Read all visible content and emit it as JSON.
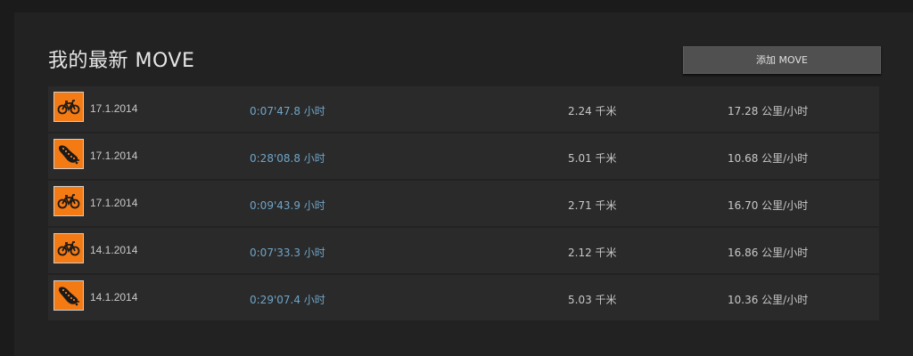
{
  "header": {
    "title": "我的最新 MOVE",
    "add_button_label": "添加 MOVE"
  },
  "colors": {
    "accent_orange": "#f47a14",
    "duration_blue": "#6fa5c8"
  },
  "moves": [
    {
      "icon": "bike-icon",
      "date": "17.1.2014",
      "duration": "0:07'47.8 小时",
      "distance": "2.24 千米",
      "speed": "17.28 公里/小时"
    },
    {
      "icon": "running-shoe-icon",
      "date": "17.1.2014",
      "duration": "0:28'08.8 小时",
      "distance": "5.01 千米",
      "speed": "10.68 公里/小时"
    },
    {
      "icon": "bike-icon",
      "date": "17.1.2014",
      "duration": "0:09'43.9 小时",
      "distance": "2.71 千米",
      "speed": "16.70 公里/小时"
    },
    {
      "icon": "bike-icon",
      "date": "14.1.2014",
      "duration": "0:07'33.3 小时",
      "distance": "2.12 千米",
      "speed": "16.86 公里/小时"
    },
    {
      "icon": "running-shoe-icon",
      "date": "14.1.2014",
      "duration": "0:29'07.4 小时",
      "distance": "5.03 千米",
      "speed": "10.36 公里/小时"
    }
  ]
}
